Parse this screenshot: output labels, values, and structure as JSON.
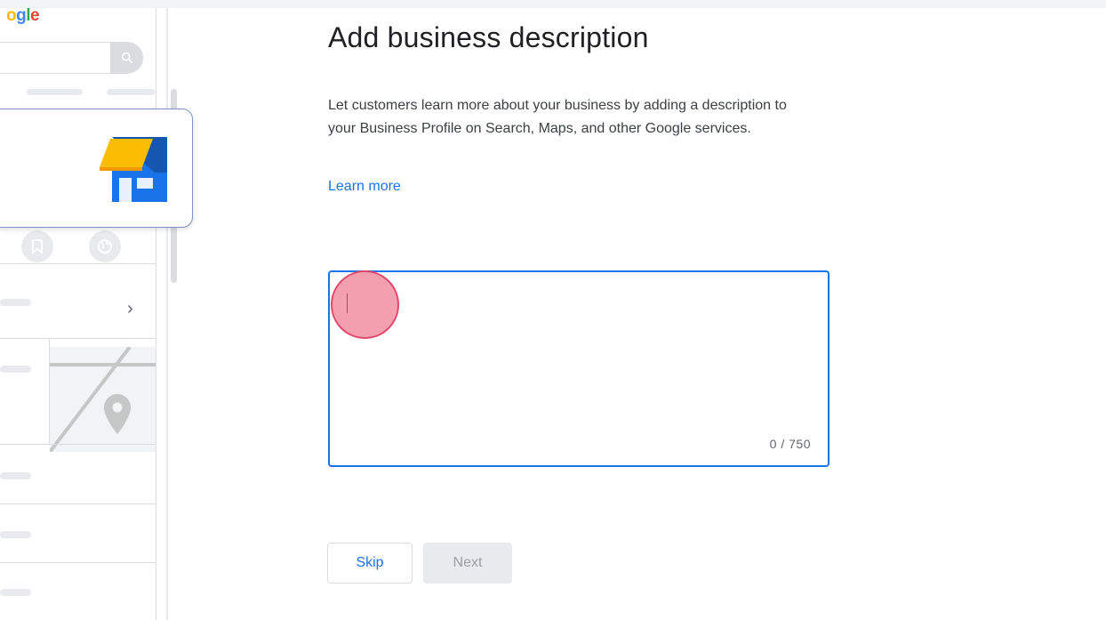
{
  "app": {
    "logo_text": "Google"
  },
  "preview": {
    "icons": [
      "search-icon",
      "storefront-icon",
      "bookmark-icon",
      "globe-icon",
      "chevron-right-icon",
      "map-pin-icon"
    ],
    "chevron": "›"
  },
  "main": {
    "title": "Add business description",
    "description": "Let customers learn more about your business by adding a description to your Business Profile on Search, Maps, and other Google services.",
    "learn_more": "Learn more",
    "textarea": {
      "value": "",
      "counter": "0 / 750"
    },
    "buttons": {
      "skip": "Skip",
      "next": "Next"
    }
  },
  "colors": {
    "accent": "#1a73e8",
    "click_marker": "#e0486a",
    "disabled_bg": "#e8eaed"
  }
}
